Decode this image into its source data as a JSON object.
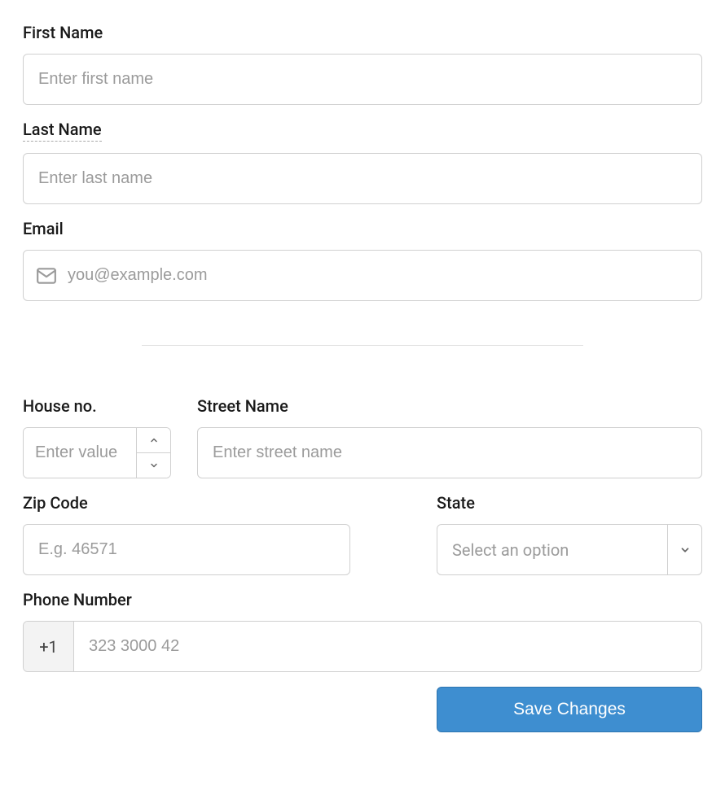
{
  "form": {
    "first_name": {
      "label": "First Name",
      "placeholder": "Enter first name",
      "value": ""
    },
    "last_name": {
      "label": "Last Name",
      "placeholder": "Enter last name",
      "value": ""
    },
    "email": {
      "label": "Email",
      "placeholder": "you@example.com",
      "value": ""
    },
    "house_no": {
      "label": "House no.",
      "placeholder": "Enter value",
      "value": ""
    },
    "street": {
      "label": "Street Name",
      "placeholder": "Enter street name",
      "value": ""
    },
    "zip": {
      "label": "Zip Code",
      "placeholder": "E.g. 46571",
      "value": ""
    },
    "state": {
      "label": "State",
      "placeholder": "Select an option",
      "value": ""
    },
    "phone": {
      "label": "Phone Number",
      "prefix": "+1",
      "placeholder": "323 3000 42",
      "value": ""
    }
  },
  "actions": {
    "save_label": "Save Changes"
  }
}
